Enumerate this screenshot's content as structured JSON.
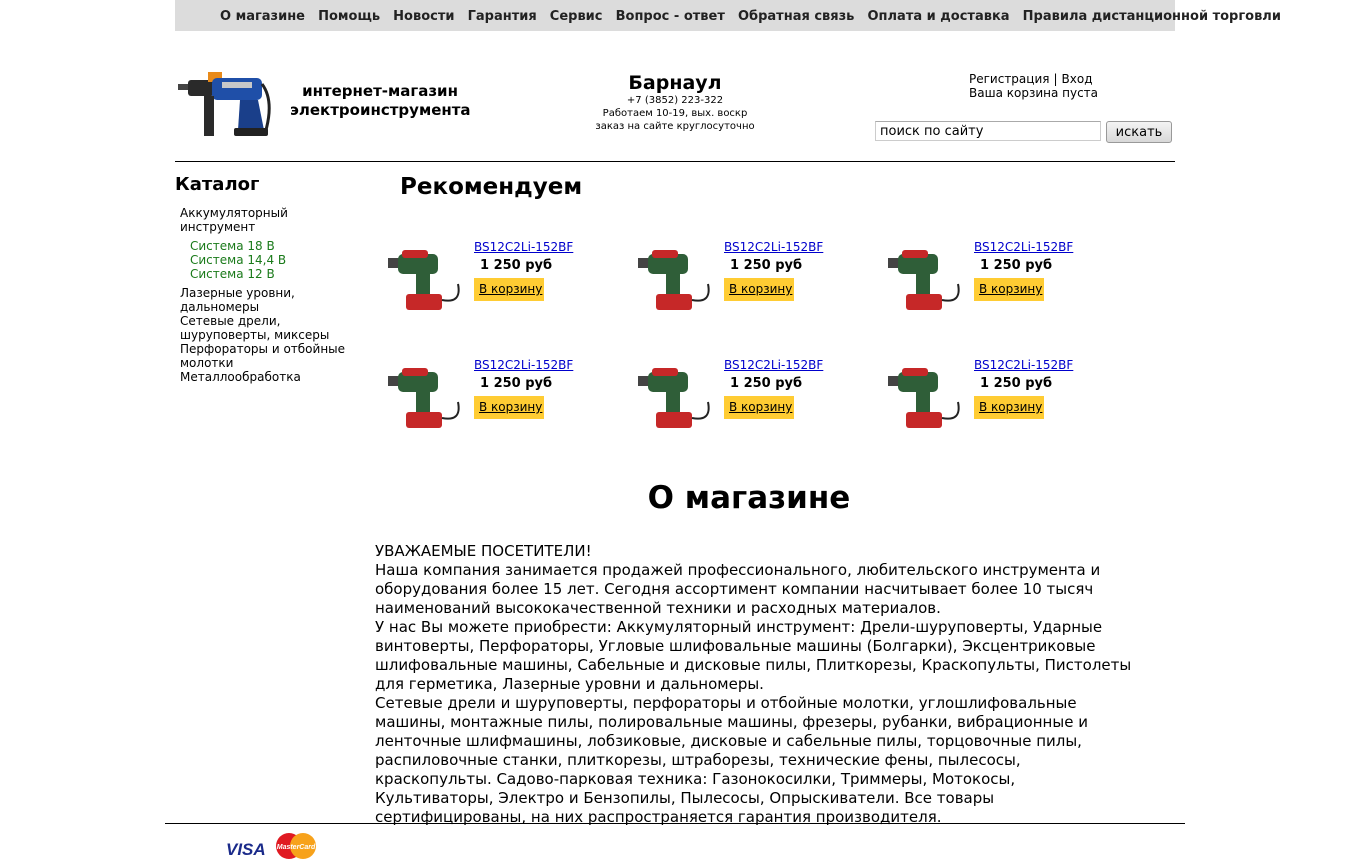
{
  "top_nav": [
    "О магазине",
    "Помощь",
    "Новости",
    "Гарантия",
    "Сервис",
    "Вопрос - ответ",
    "Обратная связь",
    "Оплата и доставка",
    "Правила дистанционной торговли"
  ],
  "brand": {
    "line1": "интернет-магазин",
    "line2": "электроинструмента"
  },
  "contact": {
    "city": "Барнаул",
    "phone": "+7 (3852) 223-322",
    "hours": "Работаем 10-19, вых. воскр",
    "note": "заказ на сайте круглосуточно"
  },
  "account": {
    "register": "Регистрация",
    "separator": "|",
    "login": "Вход",
    "cart": "Ваша корзина пуста"
  },
  "search": {
    "value": "поиск по сайту",
    "button": "искать"
  },
  "catalog": {
    "title": "Каталог",
    "items": [
      {
        "label": "Аккумуляторный инструмент",
        "sub": [
          "Система 18 В",
          "Система 14,4 В",
          "Система 12 В"
        ]
      },
      {
        "label": "Лазерные уровни, дальномеры"
      },
      {
        "label": "Сетевые дрели, шуруповерты, миксеры"
      },
      {
        "label": "Перфораторы и отбойные молотки"
      },
      {
        "label": "Металлообработка"
      }
    ]
  },
  "recommend": {
    "title": "Рекомендуем",
    "products": [
      {
        "name": "BS12C2Li-152BF",
        "price": "1 250 руб",
        "button": "В корзину"
      },
      {
        "name": "BS12C2Li-152BF",
        "price": "1 250 руб",
        "button": "В корзину"
      },
      {
        "name": "BS12C2Li-152BF",
        "price": "1 250 руб",
        "button": "В корзину"
      },
      {
        "name": "BS12C2Li-152BF",
        "price": "1 250 руб",
        "button": "В корзину"
      },
      {
        "name": "BS12C2Li-152BF",
        "price": "1 250 руб",
        "button": "В корзину"
      },
      {
        "name": "BS12C2Li-152BF",
        "price": "1 250 руб",
        "button": "В корзину"
      }
    ]
  },
  "about": {
    "title": "О магазине",
    "heading": "УВАЖАЕМЫЕ ПОСЕТИТЕЛИ!",
    "p1": "Наша компания занимается продажей профессионального, любительского инструмента и оборудования более 15 лет. Сегодня ассортимент компании насчитывает более 10 тысяч наименований высококачественной техники и расходных материалов.",
    "p2": "У нас Вы можете приобрести: Аккумуляторный инструмент: Дрели-шуруповерты, Ударные винтоверты, Перфораторы, Угловые шлифовальные машины (Болгарки), Эксцентриковые шлифовальные машины, Сабельные и дисковые пилы, Плиткорезы, Краскопульты, Пистолеты для герметика, Лазерные уровни и дальномеры.",
    "p3": "Сетевые дрели и шуруповерты, перфораторы и отбойные молотки, углошлифовальные машины, монтажные пилы, полировальные машины, фрезеры, рубанки, вибрационные и ленточные шлифмашины, лобзиковые, дисковые и сабельные пилы, торцовочные пилы, распиловочные станки, плиткорезы, штраборезы, технические фены, пылесосы, краскопульты. Садово-парковая техника: Газонокосилки, Триммеры, Мотокосы, Культиваторы, Электро и Бензопилы, Пылесосы, Опрыскиватели. Все товары сертифицированы, на них распространяется гарантия производителя."
  },
  "footer": {
    "visa": "VISA",
    "mastercard": "MasterCard"
  }
}
